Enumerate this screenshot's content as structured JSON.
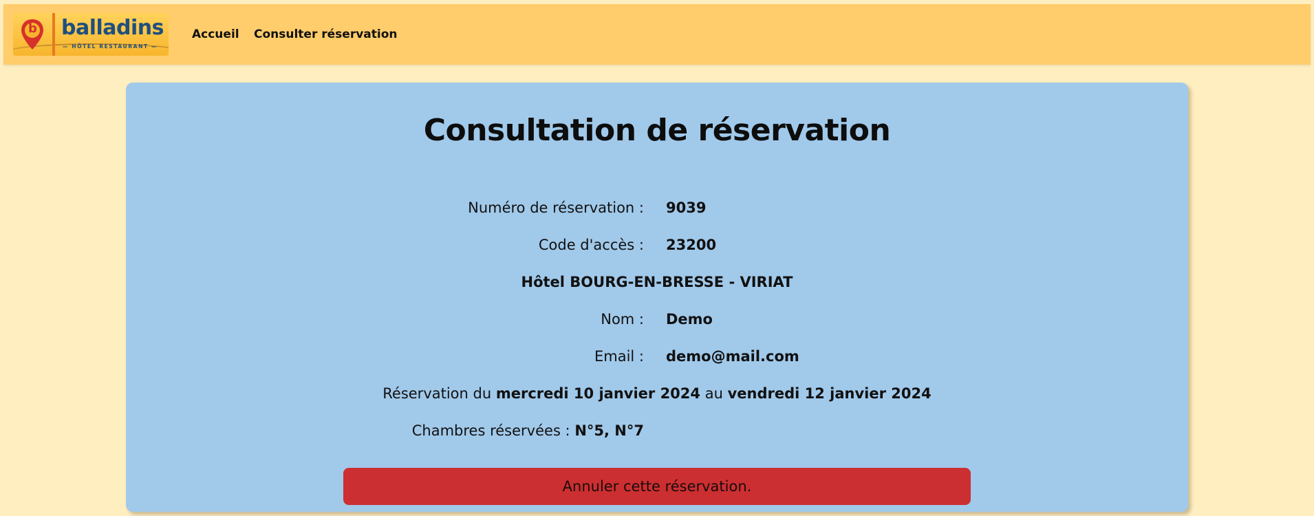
{
  "header": {
    "logo": {
      "brand": "balladins",
      "subtitle": "— HÔTEL RESTAURANT —",
      "pin_letter": "b"
    },
    "nav": [
      {
        "label": "Accueil"
      },
      {
        "label": "Consulter réservation"
      }
    ]
  },
  "main": {
    "title": "Consultation de réservation",
    "reservation_number_label": "Numéro de réservation :",
    "reservation_number": "9039",
    "access_code_label": "Code d'accès :",
    "access_code": "23200",
    "hotel": "Hôtel BOURG-EN-BRESSE - VIRIAT",
    "name_label": "Nom :",
    "name": "Demo",
    "email_label": "Email :",
    "email": "demo@mail.com",
    "dates": {
      "prefix": "Réservation du",
      "start": "mercredi 10 janvier 2024",
      "middle": "au",
      "end": "vendredi 12 janvier 2024"
    },
    "rooms_label": "Chambres réservées :",
    "rooms": "N°5, N°7",
    "cancel_label": "Annuler cette réservation."
  },
  "colors": {
    "page_bg": "#ffeebf",
    "header_bg": "#ffcd6b",
    "card_bg": "#a1c9ea",
    "cancel_bg": "#cc2f31"
  }
}
